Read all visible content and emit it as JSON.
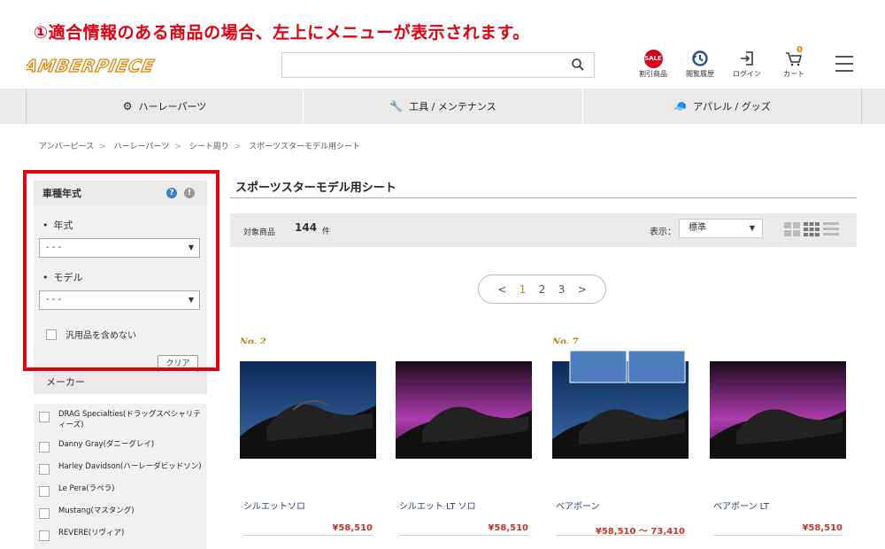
{
  "annotation": "①適合情報のある商品の場合、左上にメニューが表示されます。",
  "header": {
    "logo": "AMBERPIECE",
    "search": {
      "value": "",
      "placeholder": ""
    },
    "icons": [
      {
        "name": "sale-icon",
        "label": "割引商品",
        "badge": "SALE"
      },
      {
        "name": "history-icon",
        "label": "閲覧履歴"
      },
      {
        "name": "login-icon",
        "label": "ログイン"
      },
      {
        "name": "cart-icon",
        "label": "カート",
        "count": "0"
      }
    ]
  },
  "nav": {
    "items": [
      {
        "label": "ハーレーパーツ",
        "icon": "gears-icon"
      },
      {
        "label": "工具 / メンテナンス",
        "icon": "wrench-icon"
      },
      {
        "label": "アパレル / グッズ",
        "icon": "cap-icon"
      }
    ]
  },
  "breadcrumb": [
    "アンバーピース",
    "ハーレーパーツ",
    "シート周り",
    "スポーツスターモデル用シート"
  ],
  "filter": {
    "title": "車種年式",
    "year_label": "年式",
    "year_value": "- - -",
    "model_label": "モデル",
    "model_value": "- - -",
    "exclude_label": "汎用品を含めない",
    "clear_label": "クリア",
    "maker_title": "メーカー",
    "makers": [
      "DRAG Specialties(ドラッグスペシャリティーズ)",
      "Danny Gray(ダニーグレイ)",
      "Harley Davidson(ハーレーダビッドソン)",
      "Le Pera(ラペラ)",
      "Mustang(マスタング)",
      "REVERE(リヴィア)"
    ]
  },
  "main": {
    "title": "スポーツスターモデル用シート",
    "count_label": "対象商品",
    "count": "144",
    "count_unit": "件",
    "display_label": "表示：",
    "display_value": "標準",
    "pager": {
      "prev": "<",
      "pages": [
        "1",
        "2",
        "3"
      ],
      "next": ">",
      "current": "1"
    }
  },
  "products": [
    {
      "rank": "No. 2",
      "name": "シルエットソロ",
      "price": "¥58,510",
      "bg": "#1c4d8a"
    },
    {
      "rank": "",
      "name": "シルエット LT ソロ",
      "price": "¥58,510",
      "bg": "#7a1d7a"
    },
    {
      "rank": "No. 7",
      "name": "ベアボーン",
      "price": "¥58,510 ～ 73,410",
      "bg": "#1c4d8a"
    },
    {
      "rank": "",
      "name": "ベアボーン LT",
      "price": "¥58,510",
      "bg": "#7a1d7a"
    }
  ],
  "colors": {
    "accent": "#e00012",
    "gold": "#c38a00",
    "navy": "#2a3c7c"
  }
}
